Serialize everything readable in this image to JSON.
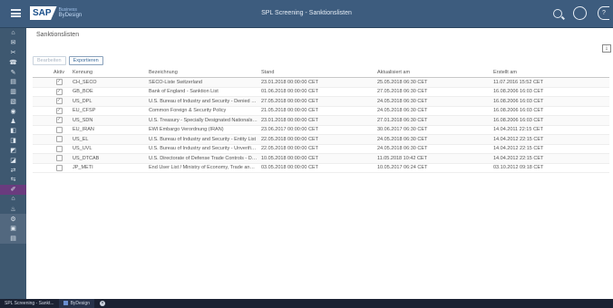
{
  "shell": {
    "logo_text": "SAP",
    "logo_sub_top": "Business",
    "logo_sub_bottom": "ByDesign",
    "title": "SPL Screening - Sanktionslisten",
    "help_glyph": "?"
  },
  "rail": {
    "icons": [
      "home-icon",
      "news-icon",
      "tag-icon",
      "phone-icon",
      "link-icon",
      "chart-icon",
      "report-icon",
      "document-icon",
      "target-icon",
      "user-icon",
      "bag-icon",
      "box-icon",
      "car-icon",
      "invoice-icon",
      "flow-icon",
      "people-icon",
      "pen-icon",
      "building-icon",
      "cart-icon",
      "tool-icon",
      "screen-icon",
      "list-icon"
    ],
    "glyphs": [
      "⌂",
      "✉",
      "✂",
      "☎",
      "✎",
      "▤",
      "▥",
      "▧",
      "◉",
      "♟",
      "◧",
      "◨",
      "◩",
      "◪",
      "⇄",
      "⇆",
      "✐",
      "⌂",
      "♨",
      "⚙",
      "▣",
      "▤"
    ]
  },
  "page": {
    "title": "Sanktionslisten",
    "export_glyph": "⤓"
  },
  "toolbar": {
    "edit_label": "Bearbeiten",
    "copy_label": "Exportieren"
  },
  "table": {
    "headers": [
      "Aktiv",
      "Kennung",
      "Bezeichnung",
      "Stand",
      "Aktualisiert am",
      "Erstellt am"
    ],
    "rows": [
      {
        "active": true,
        "id": "CH_SECO",
        "name": "SECO-Liste Switzerland",
        "status": "23.01.2018 00:00:00 CET",
        "updated": "25.05.2018 06:30 CET",
        "created": "11.07.2016 15:52 CET"
      },
      {
        "active": true,
        "id": "GB_BOE",
        "name": "Bank of England - Sanktion List",
        "status": "01.06.2018 00:00:00 CET",
        "updated": "27.05.2018 06:30 CET",
        "created": "16.08.2006 16:03 CET"
      },
      {
        "active": true,
        "id": "US_DPL",
        "name": "U.S. Bureau of Industry and Security - Denied Persons",
        "status": "27.05.2018 00:00:00 CET",
        "updated": "24.05.2018 06:30 CET",
        "created": "16.08.2006 16:03 CET"
      },
      {
        "active": true,
        "id": "EU_CFSP",
        "name": "Common Foreign & Security Policy",
        "status": "21.05.2018 00:00:00 CET",
        "updated": "24.05.2018 06:30 CET",
        "created": "16.08.2006 16:03 CET"
      },
      {
        "active": true,
        "id": "US_SDN",
        "name": "U.S. Treasury - Specially Designated Nationals List",
        "status": "23.01.2018 00:00:00 CET",
        "updated": "27.01.2018 06:30 CET",
        "created": "16.08.2006 16:03 CET"
      },
      {
        "active": false,
        "id": "EU_IRAN",
        "name": "EWI Embargo Verordnung (IRAN)",
        "status": "23.06.2017 00:00:00 CET",
        "updated": "30.06.2017 06:30 CET",
        "created": "14.04.2011 22:15 CET"
      },
      {
        "active": false,
        "id": "US_EL",
        "name": "U.S. Bureau of Industry and Security - Entity List",
        "status": "22.05.2018 00:00:00 CET",
        "updated": "24.05.2018 06:30 CET",
        "created": "14.04.2012 22:15 CET"
      },
      {
        "active": false,
        "id": "US_UVL",
        "name": "U.S. Bureau of Industry and Security - Unverified List",
        "status": "22.05.2018 00:00:00 CET",
        "updated": "24.05.2018 06:30 CET",
        "created": "14.04.2012 22:15 CET"
      },
      {
        "active": false,
        "id": "US_DTCAB",
        "name": "U.S. Directorate of Defense Trade Controls - Debarred",
        "status": "10.05.2018 00:00:00 CET",
        "updated": "11.05.2018 10:42 CET",
        "created": "14.04.2012 22:15 CET"
      },
      {
        "active": false,
        "id": "JP_METI",
        "name": "End User List / Ministry of Economy, Trade and Industry",
        "status": "03.05.2018 00:00:00 CET",
        "updated": "10.05.2017 06:24 CET",
        "created": "03.10.2012 09:18 CET"
      }
    ]
  },
  "taskbar": {
    "item1": "SPL Screening - Sankt...",
    "item2": "ByDesign",
    "close_glyph": "×"
  }
}
